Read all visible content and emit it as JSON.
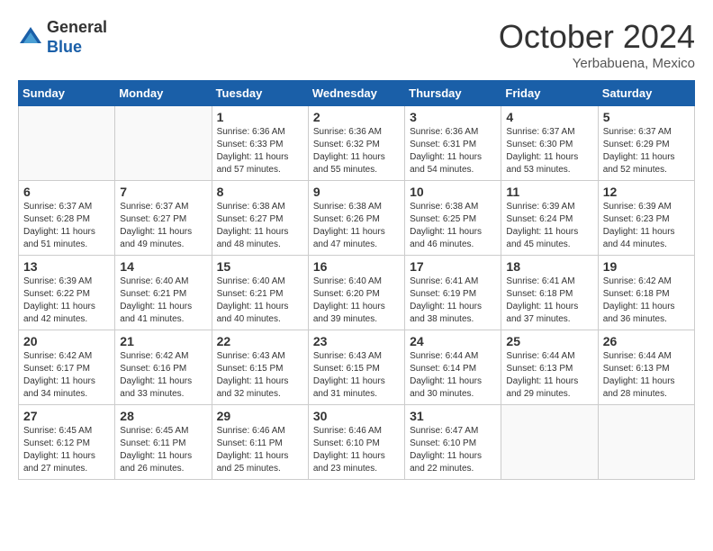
{
  "header": {
    "logo_line1": "General",
    "logo_line2": "Blue",
    "month": "October 2024",
    "location": "Yerbabuena, Mexico"
  },
  "weekdays": [
    "Sunday",
    "Monday",
    "Tuesday",
    "Wednesday",
    "Thursday",
    "Friday",
    "Saturday"
  ],
  "weeks": [
    [
      {
        "day": "",
        "info": ""
      },
      {
        "day": "",
        "info": ""
      },
      {
        "day": "1",
        "info": "Sunrise: 6:36 AM\nSunset: 6:33 PM\nDaylight: 11 hours and 57 minutes."
      },
      {
        "day": "2",
        "info": "Sunrise: 6:36 AM\nSunset: 6:32 PM\nDaylight: 11 hours and 55 minutes."
      },
      {
        "day": "3",
        "info": "Sunrise: 6:36 AM\nSunset: 6:31 PM\nDaylight: 11 hours and 54 minutes."
      },
      {
        "day": "4",
        "info": "Sunrise: 6:37 AM\nSunset: 6:30 PM\nDaylight: 11 hours and 53 minutes."
      },
      {
        "day": "5",
        "info": "Sunrise: 6:37 AM\nSunset: 6:29 PM\nDaylight: 11 hours and 52 minutes."
      }
    ],
    [
      {
        "day": "6",
        "info": "Sunrise: 6:37 AM\nSunset: 6:28 PM\nDaylight: 11 hours and 51 minutes."
      },
      {
        "day": "7",
        "info": "Sunrise: 6:37 AM\nSunset: 6:27 PM\nDaylight: 11 hours and 49 minutes."
      },
      {
        "day": "8",
        "info": "Sunrise: 6:38 AM\nSunset: 6:27 PM\nDaylight: 11 hours and 48 minutes."
      },
      {
        "day": "9",
        "info": "Sunrise: 6:38 AM\nSunset: 6:26 PM\nDaylight: 11 hours and 47 minutes."
      },
      {
        "day": "10",
        "info": "Sunrise: 6:38 AM\nSunset: 6:25 PM\nDaylight: 11 hours and 46 minutes."
      },
      {
        "day": "11",
        "info": "Sunrise: 6:39 AM\nSunset: 6:24 PM\nDaylight: 11 hours and 45 minutes."
      },
      {
        "day": "12",
        "info": "Sunrise: 6:39 AM\nSunset: 6:23 PM\nDaylight: 11 hours and 44 minutes."
      }
    ],
    [
      {
        "day": "13",
        "info": "Sunrise: 6:39 AM\nSunset: 6:22 PM\nDaylight: 11 hours and 42 minutes."
      },
      {
        "day": "14",
        "info": "Sunrise: 6:40 AM\nSunset: 6:21 PM\nDaylight: 11 hours and 41 minutes."
      },
      {
        "day": "15",
        "info": "Sunrise: 6:40 AM\nSunset: 6:21 PM\nDaylight: 11 hours and 40 minutes."
      },
      {
        "day": "16",
        "info": "Sunrise: 6:40 AM\nSunset: 6:20 PM\nDaylight: 11 hours and 39 minutes."
      },
      {
        "day": "17",
        "info": "Sunrise: 6:41 AM\nSunset: 6:19 PM\nDaylight: 11 hours and 38 minutes."
      },
      {
        "day": "18",
        "info": "Sunrise: 6:41 AM\nSunset: 6:18 PM\nDaylight: 11 hours and 37 minutes."
      },
      {
        "day": "19",
        "info": "Sunrise: 6:42 AM\nSunset: 6:18 PM\nDaylight: 11 hours and 36 minutes."
      }
    ],
    [
      {
        "day": "20",
        "info": "Sunrise: 6:42 AM\nSunset: 6:17 PM\nDaylight: 11 hours and 34 minutes."
      },
      {
        "day": "21",
        "info": "Sunrise: 6:42 AM\nSunset: 6:16 PM\nDaylight: 11 hours and 33 minutes."
      },
      {
        "day": "22",
        "info": "Sunrise: 6:43 AM\nSunset: 6:15 PM\nDaylight: 11 hours and 32 minutes."
      },
      {
        "day": "23",
        "info": "Sunrise: 6:43 AM\nSunset: 6:15 PM\nDaylight: 11 hours and 31 minutes."
      },
      {
        "day": "24",
        "info": "Sunrise: 6:44 AM\nSunset: 6:14 PM\nDaylight: 11 hours and 30 minutes."
      },
      {
        "day": "25",
        "info": "Sunrise: 6:44 AM\nSunset: 6:13 PM\nDaylight: 11 hours and 29 minutes."
      },
      {
        "day": "26",
        "info": "Sunrise: 6:44 AM\nSunset: 6:13 PM\nDaylight: 11 hours and 28 minutes."
      }
    ],
    [
      {
        "day": "27",
        "info": "Sunrise: 6:45 AM\nSunset: 6:12 PM\nDaylight: 11 hours and 27 minutes."
      },
      {
        "day": "28",
        "info": "Sunrise: 6:45 AM\nSunset: 6:11 PM\nDaylight: 11 hours and 26 minutes."
      },
      {
        "day": "29",
        "info": "Sunrise: 6:46 AM\nSunset: 6:11 PM\nDaylight: 11 hours and 25 minutes."
      },
      {
        "day": "30",
        "info": "Sunrise: 6:46 AM\nSunset: 6:10 PM\nDaylight: 11 hours and 23 minutes."
      },
      {
        "day": "31",
        "info": "Sunrise: 6:47 AM\nSunset: 6:10 PM\nDaylight: 11 hours and 22 minutes."
      },
      {
        "day": "",
        "info": ""
      },
      {
        "day": "",
        "info": ""
      }
    ]
  ]
}
